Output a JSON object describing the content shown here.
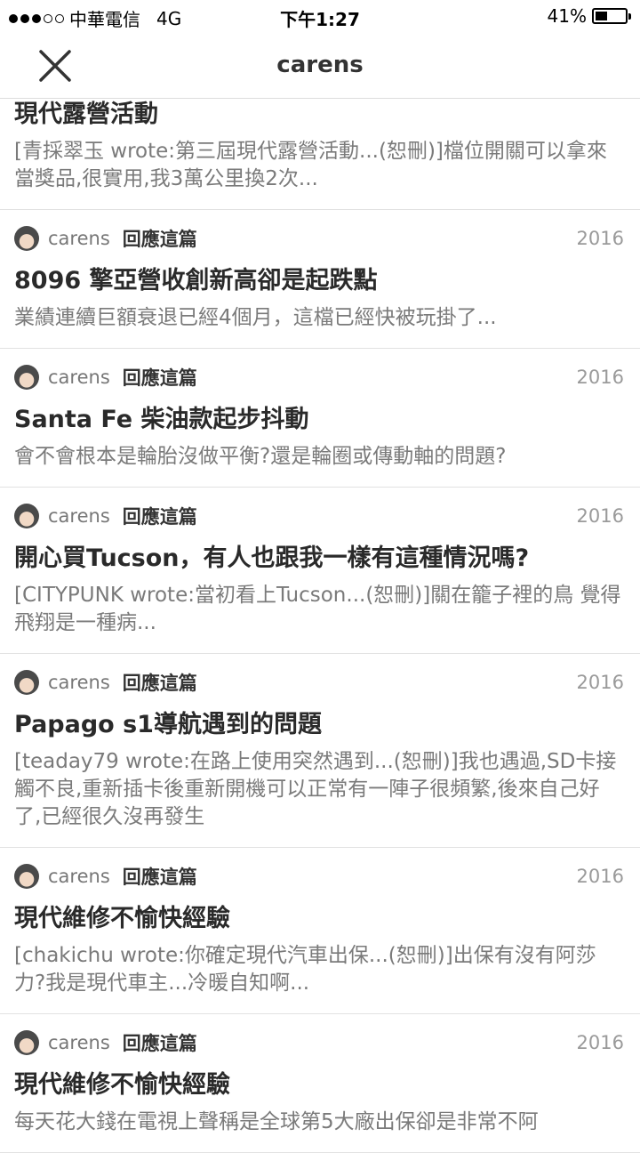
{
  "status_bar": {
    "carrier": "中華電信",
    "network": "4G",
    "time": "下午1:27",
    "battery_text": "41%",
    "battery_level": 0.41
  },
  "nav": {
    "title": "carens",
    "close_icon": "close-icon"
  },
  "posts": [
    {
      "title": "現代露營活動",
      "excerpt": "[青採翠玉 wrote:第三屆現代露營活動...(恕刪)]檔位開關可以拿來當獎品,很實用,我3萬公里換2次..."
    },
    {
      "author": "carens",
      "action": "回應這篇",
      "year": "2016",
      "title": "8096 擎亞營收創新高卻是起跌點",
      "excerpt": "業績連續巨額衰退已經4個月，這檔已經快被玩掛了..."
    },
    {
      "author": "carens",
      "action": "回應這篇",
      "year": "2016",
      "title": "Santa Fe 柴油款起步抖動",
      "excerpt": "會不會根本是輪胎沒做平衡?還是輪圈或傳動軸的問題?"
    },
    {
      "author": "carens",
      "action": "回應這篇",
      "year": "2016",
      "title": "開心買Tucson，有人也跟我一樣有這種情況嗎?",
      "excerpt": "[CITYPUNK wrote:當初看上Tucson...(恕刪)]關在籠子裡的鳥 覺得飛翔是一種病..."
    },
    {
      "author": "carens",
      "action": "回應這篇",
      "year": "2016",
      "title": "Papago s1導航遇到的問題",
      "excerpt": "[teaday79 wrote:在路上使用突然遇到...(恕刪)]我也遇過,SD卡接觸不良,重新插卡後重新開機可以正常有一陣子很頻繁,後來自己好了,已經很久沒再發生"
    },
    {
      "author": "carens",
      "action": "回應這篇",
      "year": "2016",
      "title": "現代維修不愉快經驗",
      "excerpt": "[chakichu wrote:你確定現代汽車出保...(恕刪)]出保有沒有阿莎力?我是現代車主...冷暖自知啊..."
    },
    {
      "author": "carens",
      "action": "回應這篇",
      "year": "2016",
      "title": "現代維修不愉快經驗",
      "excerpt": "每天花大錢在電視上聲稱是全球第5大廠出保卻是非常不阿"
    }
  ]
}
